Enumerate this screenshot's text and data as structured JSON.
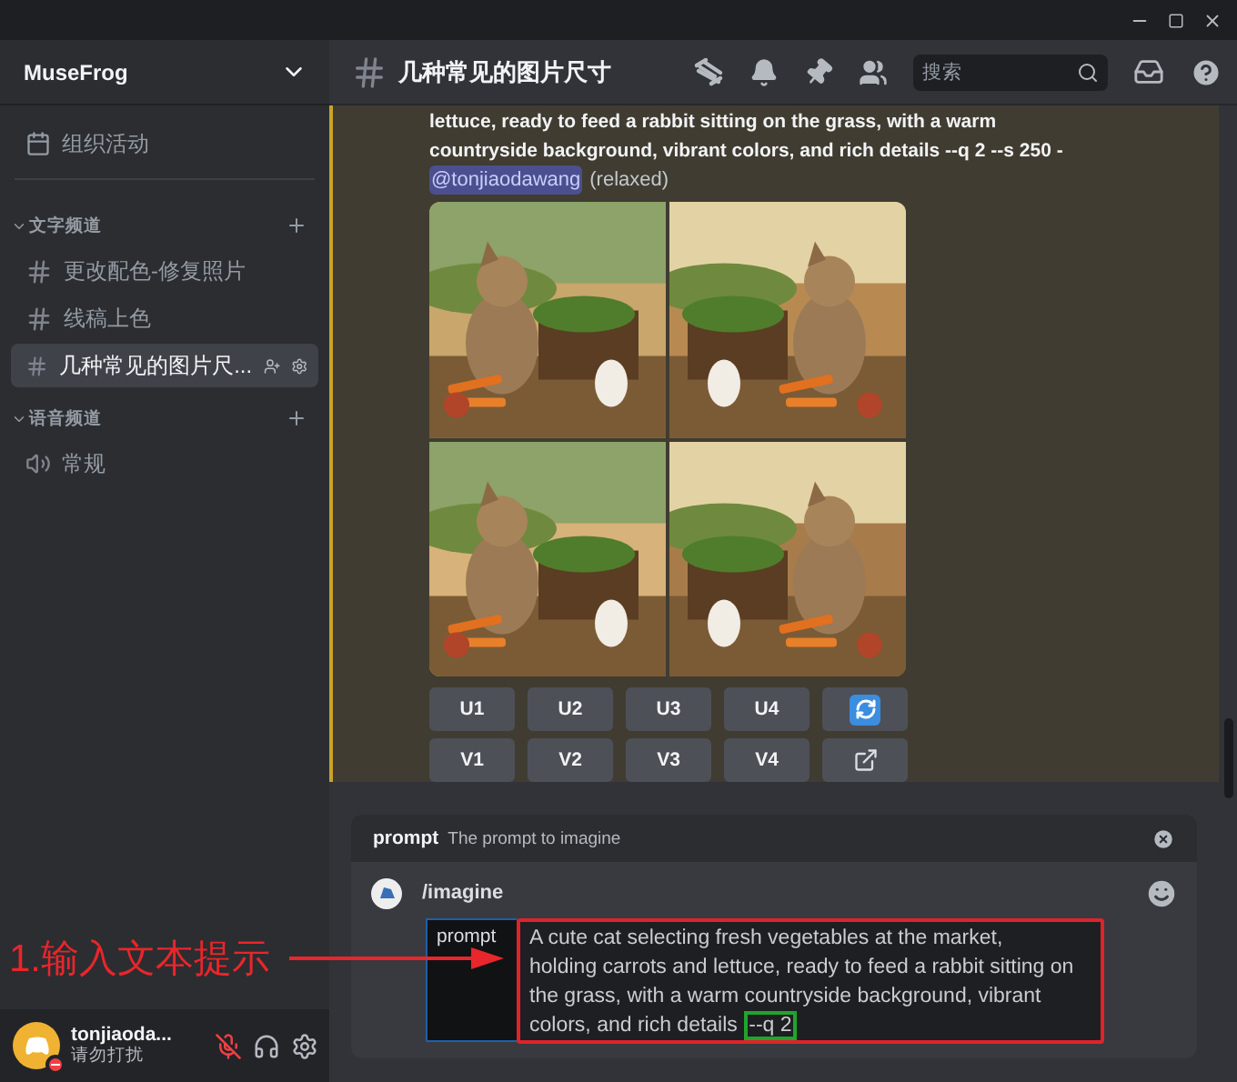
{
  "server": {
    "name": "MuseFrog"
  },
  "sidebar": {
    "event_label": "组织活动",
    "categories": [
      {
        "name": "文字频道",
        "expanded": true,
        "channels": [
          {
            "name": "更改配色-修复照片",
            "kind": "text",
            "selected": false
          },
          {
            "name": "线稿上色",
            "kind": "text",
            "selected": false
          },
          {
            "name": "几种常见的图片尺...",
            "kind": "text",
            "selected": true
          }
        ]
      },
      {
        "name": "语音频道",
        "expanded": true,
        "channels": [
          {
            "name": "常规",
            "kind": "voice",
            "selected": false
          }
        ]
      }
    ]
  },
  "user": {
    "name": "tonjiaoda...",
    "status": "请勿打扰",
    "muted": true
  },
  "channel_header": {
    "title": "几种常见的图片尺寸",
    "search_placeholder": "搜索"
  },
  "message": {
    "text_lines": [
      "lettuce, ready to feed a rabbit sitting on the grass, with a warm",
      "countryside background, vibrant colors, and rich details --q 2 --s 250 -"
    ],
    "mention": "@tonjiaodawang",
    "suffix": "(relaxed)",
    "images": [
      {
        "kind": "picture"
      },
      {
        "kind": "picture"
      },
      {
        "kind": "picture"
      },
      {
        "kind": "picture"
      }
    ],
    "button_rows": [
      [
        {
          "kind": "text",
          "label": "U1"
        },
        {
          "kind": "text",
          "label": "U2"
        },
        {
          "kind": "text",
          "label": "U3"
        },
        {
          "kind": "text",
          "label": "U4"
        },
        {
          "kind": "refresh"
        }
      ],
      [
        {
          "kind": "text",
          "label": "V1"
        },
        {
          "kind": "text",
          "label": "V2"
        },
        {
          "kind": "text",
          "label": "V3"
        },
        {
          "kind": "text",
          "label": "V4"
        },
        {
          "kind": "open"
        }
      ]
    ]
  },
  "command": {
    "option_name": "prompt",
    "option_description": "The prompt to imagine",
    "name": "/imagine",
    "field_label": "prompt",
    "value": "A cute cat selecting fresh vegetables at the market, holding carrots and lettuce, ready to feed a rabbit sitting on the grass, with a warm countryside background, vibrant colors, and rich details",
    "highlight": "--q 2"
  },
  "annotation": {
    "label": "1.输入文本提示"
  }
}
